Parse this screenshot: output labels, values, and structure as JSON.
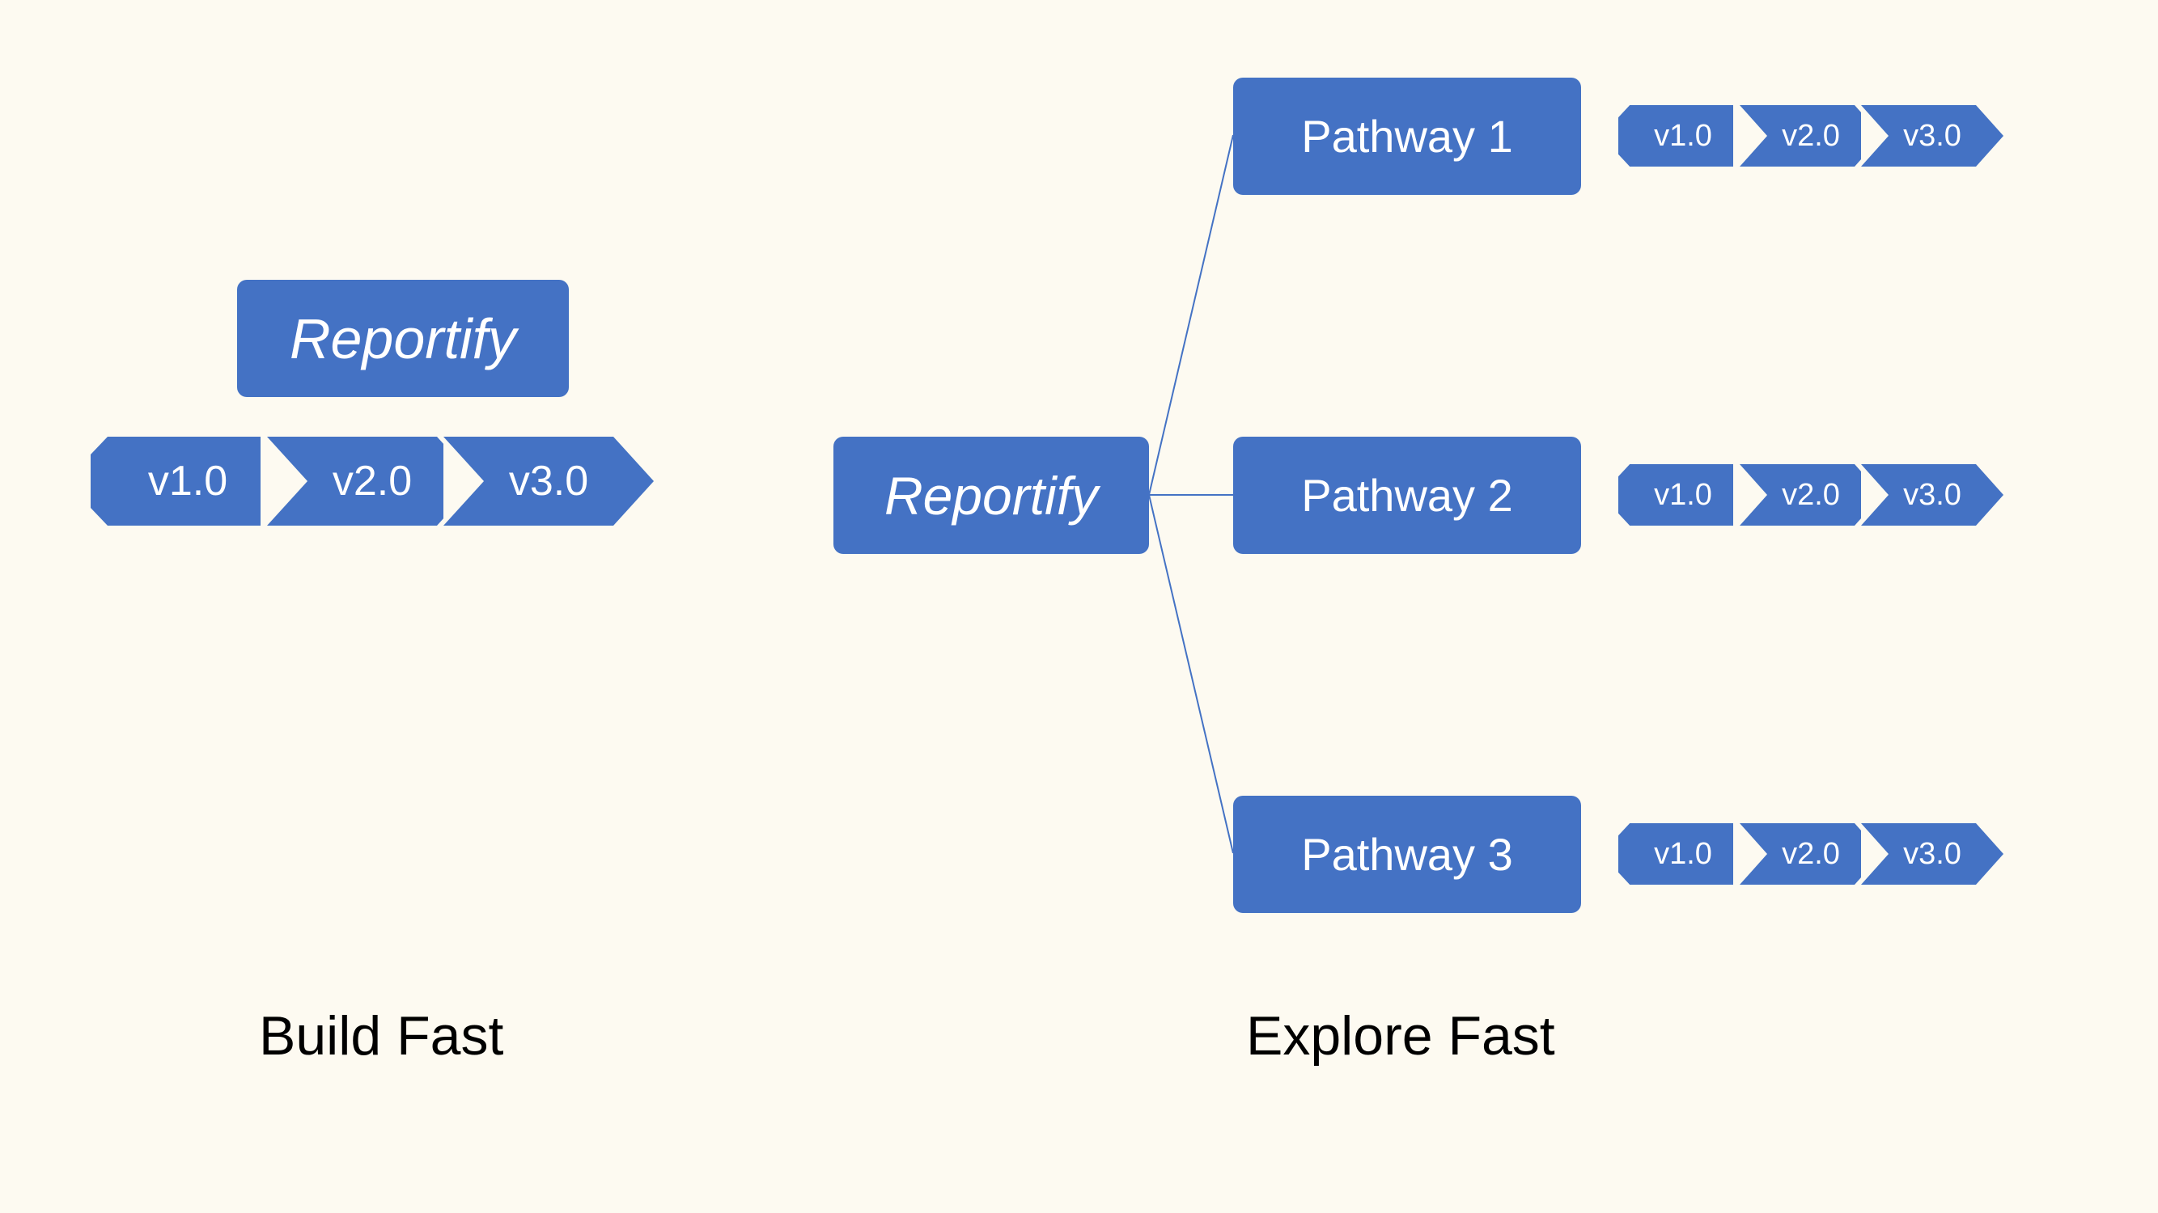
{
  "left": {
    "product": "Reportify",
    "versions": [
      "v1.0",
      "v2.0",
      "v3.0"
    ],
    "caption": "Build Fast"
  },
  "right": {
    "product": "Reportify",
    "pathways": [
      {
        "label": "Pathway 1",
        "versions": [
          "v1.0",
          "v2.0",
          "v3.0"
        ]
      },
      {
        "label": "Pathway 2",
        "versions": [
          "v1.0",
          "v2.0",
          "v3.0"
        ]
      },
      {
        "label": "Pathway 3",
        "versions": [
          "v1.0",
          "v2.0",
          "v3.0"
        ]
      }
    ],
    "caption": "Explore Fast"
  },
  "colors": {
    "accent": "#4472c4",
    "background": "#fdfaf1"
  }
}
